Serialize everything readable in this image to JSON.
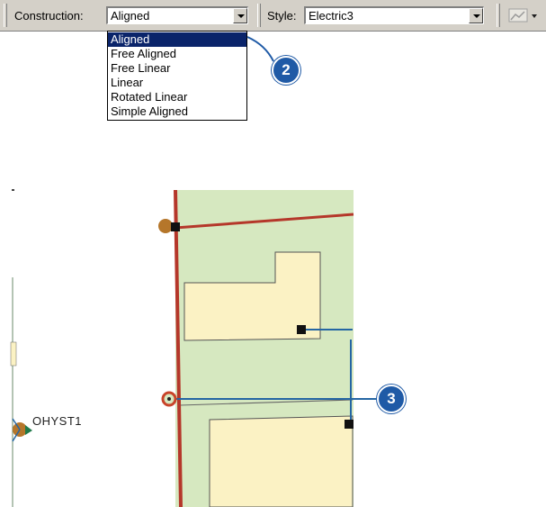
{
  "toolbar": {
    "construction_label": "Construction:",
    "construction_value": "Aligned",
    "style_label": "Style:",
    "style_value": "Electric3",
    "tool_icon": "sketch-tool-icon"
  },
  "construction_options": [
    {
      "label": "Aligned",
      "selected": true
    },
    {
      "label": "Free Aligned",
      "selected": false
    },
    {
      "label": "Free Linear",
      "selected": false
    },
    {
      "label": "Linear",
      "selected": false
    },
    {
      "label": "Rotated Linear",
      "selected": false
    },
    {
      "label": "Simple Aligned",
      "selected": false
    }
  ],
  "callouts": {
    "two": "2",
    "three": "3"
  },
  "map": {
    "feature_label": "OHYST1",
    "colors": {
      "parcel": "#d6e8c0",
      "building": "#fbf2c4",
      "primary_line": "#b5372a",
      "secondary_line": "#2566a3",
      "pole": "#b5762a",
      "callout": "#1f5aa6"
    }
  }
}
